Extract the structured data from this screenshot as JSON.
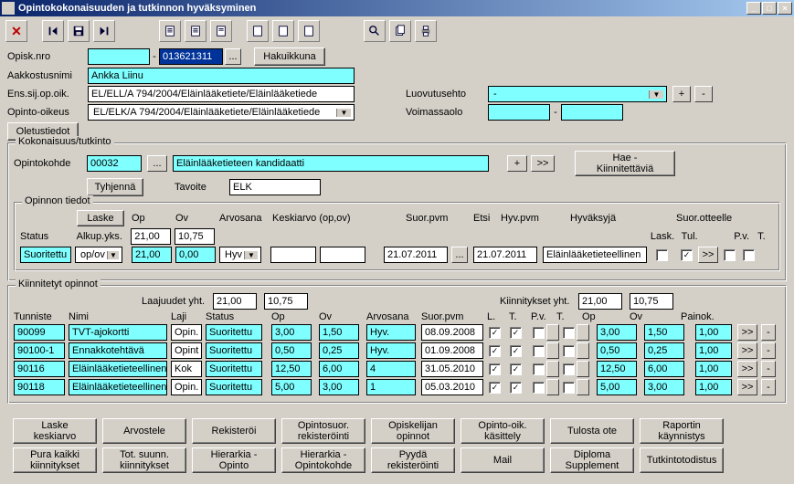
{
  "window": {
    "title": "Opintokokonaisuuden ja tutkinnon hyväksyminen"
  },
  "labels": {
    "opisk_nro": "Opisk.nro",
    "aakkostusnimi": "Aakkostusnimi",
    "ens_sij": "Ens.sij.op.oik.",
    "opinto_oikeus": "Opinto-oikeus",
    "oletustiedot": "Oletustiedot",
    "luovutusehto": "Luovutusehto",
    "voimassaolo": "Voimassaolo",
    "hakuikkuna": "Hakuikkuna",
    "kokonaisuus": "Kokonaisuus/tutkinto",
    "opintokohde": "Opintokohde",
    "tyhjenna": "Tyhjennä",
    "tavoite": "Tavoite",
    "hae": "Hae - Kiinnitettäviä",
    "opinnon_tiedot": "Opinnon tiedot",
    "laske": "Laske",
    "status": "Status",
    "alkup": "Alkup.yks.",
    "op": "Op",
    "ov": "Ov",
    "arvosana": "Arvosana",
    "keskiarvo": "Keskiarvo (op,ov)",
    "suor_pvm": "Suor.pvm",
    "etsi": "Etsi",
    "hyv_pvm": "Hyv.pvm",
    "hyvaksyja": "Hyväksyjä",
    "suor_otteelle": "Suor.otteelle",
    "lask": "Lask.",
    "tul": "Tul.",
    "pv": "P.v.",
    "t": "T.",
    "opov": "op/ov",
    "hyv": "Hyv",
    "kiinnitetyt": "Kiinnitetyt opinnot",
    "laajuudet_yht": "Laajuudet yht.",
    "kiinnitykset_yht": "Kiinnitykset yht.",
    "tunniste": "Tunniste",
    "nimi": "Nimi",
    "laji": "Laji",
    "l": "L.",
    "painok": "Painok.",
    "dash": "-"
  },
  "header": {
    "nro_left": "",
    "nro_code": "013621311",
    "aakkostusnimi": "Ankka Liinu",
    "ens_sij": "EL/ELL/A 794/2004/Eläinlääketiete/Eläinlääketiede",
    "opinto_oikeus": "EL/ELK/A 794/2004/Eläinlääketiete/Eläinlääketiede",
    "luovutusehto": "-",
    "voimassa_from": "",
    "voimassa_to": ""
  },
  "kokonaisuus": {
    "opintokohde_code": "00032",
    "opintokohde_name": "Eläinlääketieteen kandidaatti",
    "tavoite": "ELK"
  },
  "opinnon": {
    "status": "Suoritettu",
    "op_row1": "21,00",
    "op_row2": "21,00",
    "ov_row1": "10,75",
    "ov_row2": "0,00",
    "suor_pvm": "21.07.2011",
    "hyv_pvm": "21.07.2011",
    "hyvaksyja": "Eläinlääketieteellinen"
  },
  "totals": {
    "laaj_op": "21,00",
    "laaj_ov": "10,75",
    "kiin_op": "21,00",
    "kiin_ov": "10,75"
  },
  "rows": [
    {
      "tunniste": "90099",
      "nimi": "TVT-ajokortti",
      "laji": "Opin.",
      "status": "Suoritettu",
      "op": "3,00",
      "ov": "1,50",
      "arv": "Hyv.",
      "pvm": "08.09.2008",
      "l": true,
      "t": true,
      "pv": false,
      "t2": false,
      "kop": "3,00",
      "kov": "1,50",
      "pk": "1,00"
    },
    {
      "tunniste": "90100-1",
      "nimi": "Ennakkotehtävä",
      "laji": "Opint",
      "status": "Suoritettu",
      "op": "0,50",
      "ov": "0,25",
      "arv": "Hyv.",
      "pvm": "01.09.2008",
      "l": true,
      "t": true,
      "pv": false,
      "t2": false,
      "kop": "0,50",
      "kov": "0,25",
      "pk": "1,00"
    },
    {
      "tunniste": "90116",
      "nimi": "Eläinlääketieteellinen",
      "laji": "Kok",
      "status": "Suoritettu",
      "op": "12,50",
      "ov": "6,00",
      "arv": "4",
      "pvm": "31.05.2010",
      "l": true,
      "t": true,
      "pv": false,
      "t2": false,
      "kop": "12,50",
      "kov": "6,00",
      "pk": "1,00"
    },
    {
      "tunniste": "90118",
      "nimi": "Eläinlääketieteellinen",
      "laji": "Opin.",
      "status": "Suoritettu",
      "op": "5,00",
      "ov": "3,00",
      "arv": "1",
      "pvm": "05.03.2010",
      "l": true,
      "t": true,
      "pv": false,
      "t2": false,
      "kop": "5,00",
      "kov": "3,00",
      "pk": "1,00"
    }
  ],
  "footer": {
    "r1": [
      "Laske keskiarvo",
      "Arvostele",
      "Rekisteröi",
      "Opintosuor. rekisteröinti",
      "Opiskelijan opinnot",
      "Opinto-oik. käsittely",
      "Tulosta ote",
      "Raportin käynnistys"
    ],
    "r2": [
      "Pura kaikki kiinnitykset",
      "Tot. suunn. kiinnitykset",
      "Hierarkia - Opinto",
      "Hierarkia - Opintokohde",
      "Pyydä rekisteröinti",
      "Mail",
      "Diploma Supplement",
      "Tutkintotodistus"
    ]
  },
  "sym": {
    "plus": "+",
    "minus": "-",
    "gtgt": ">>",
    "ellipsis": "..."
  }
}
